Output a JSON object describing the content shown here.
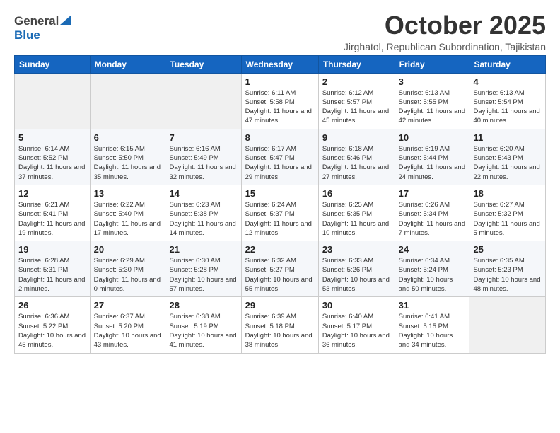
{
  "header": {
    "logo_line1": "General",
    "logo_line2": "Blue",
    "month_title": "October 2025",
    "subtitle": "Jirghatol, Republican Subordination, Tajikistan"
  },
  "weekdays": [
    "Sunday",
    "Monday",
    "Tuesday",
    "Wednesday",
    "Thursday",
    "Friday",
    "Saturday"
  ],
  "weeks": [
    [
      {
        "day": "",
        "info": ""
      },
      {
        "day": "",
        "info": ""
      },
      {
        "day": "",
        "info": ""
      },
      {
        "day": "1",
        "info": "Sunrise: 6:11 AM\nSunset: 5:58 PM\nDaylight: 11 hours\nand 47 minutes."
      },
      {
        "day": "2",
        "info": "Sunrise: 6:12 AM\nSunset: 5:57 PM\nDaylight: 11 hours\nand 45 minutes."
      },
      {
        "day": "3",
        "info": "Sunrise: 6:13 AM\nSunset: 5:55 PM\nDaylight: 11 hours\nand 42 minutes."
      },
      {
        "day": "4",
        "info": "Sunrise: 6:13 AM\nSunset: 5:54 PM\nDaylight: 11 hours\nand 40 minutes."
      }
    ],
    [
      {
        "day": "5",
        "info": "Sunrise: 6:14 AM\nSunset: 5:52 PM\nDaylight: 11 hours\nand 37 minutes."
      },
      {
        "day": "6",
        "info": "Sunrise: 6:15 AM\nSunset: 5:50 PM\nDaylight: 11 hours\nand 35 minutes."
      },
      {
        "day": "7",
        "info": "Sunrise: 6:16 AM\nSunset: 5:49 PM\nDaylight: 11 hours\nand 32 minutes."
      },
      {
        "day": "8",
        "info": "Sunrise: 6:17 AM\nSunset: 5:47 PM\nDaylight: 11 hours\nand 29 minutes."
      },
      {
        "day": "9",
        "info": "Sunrise: 6:18 AM\nSunset: 5:46 PM\nDaylight: 11 hours\nand 27 minutes."
      },
      {
        "day": "10",
        "info": "Sunrise: 6:19 AM\nSunset: 5:44 PM\nDaylight: 11 hours\nand 24 minutes."
      },
      {
        "day": "11",
        "info": "Sunrise: 6:20 AM\nSunset: 5:43 PM\nDaylight: 11 hours\nand 22 minutes."
      }
    ],
    [
      {
        "day": "12",
        "info": "Sunrise: 6:21 AM\nSunset: 5:41 PM\nDaylight: 11 hours\nand 19 minutes."
      },
      {
        "day": "13",
        "info": "Sunrise: 6:22 AM\nSunset: 5:40 PM\nDaylight: 11 hours\nand 17 minutes."
      },
      {
        "day": "14",
        "info": "Sunrise: 6:23 AM\nSunset: 5:38 PM\nDaylight: 11 hours\nand 14 minutes."
      },
      {
        "day": "15",
        "info": "Sunrise: 6:24 AM\nSunset: 5:37 PM\nDaylight: 11 hours\nand 12 minutes."
      },
      {
        "day": "16",
        "info": "Sunrise: 6:25 AM\nSunset: 5:35 PM\nDaylight: 11 hours\nand 10 minutes."
      },
      {
        "day": "17",
        "info": "Sunrise: 6:26 AM\nSunset: 5:34 PM\nDaylight: 11 hours\nand 7 minutes."
      },
      {
        "day": "18",
        "info": "Sunrise: 6:27 AM\nSunset: 5:32 PM\nDaylight: 11 hours\nand 5 minutes."
      }
    ],
    [
      {
        "day": "19",
        "info": "Sunrise: 6:28 AM\nSunset: 5:31 PM\nDaylight: 11 hours\nand 2 minutes."
      },
      {
        "day": "20",
        "info": "Sunrise: 6:29 AM\nSunset: 5:30 PM\nDaylight: 11 hours\nand 0 minutes."
      },
      {
        "day": "21",
        "info": "Sunrise: 6:30 AM\nSunset: 5:28 PM\nDaylight: 10 hours\nand 57 minutes."
      },
      {
        "day": "22",
        "info": "Sunrise: 6:32 AM\nSunset: 5:27 PM\nDaylight: 10 hours\nand 55 minutes."
      },
      {
        "day": "23",
        "info": "Sunrise: 6:33 AM\nSunset: 5:26 PM\nDaylight: 10 hours\nand 53 minutes."
      },
      {
        "day": "24",
        "info": "Sunrise: 6:34 AM\nSunset: 5:24 PM\nDaylight: 10 hours\nand 50 minutes."
      },
      {
        "day": "25",
        "info": "Sunrise: 6:35 AM\nSunset: 5:23 PM\nDaylight: 10 hours\nand 48 minutes."
      }
    ],
    [
      {
        "day": "26",
        "info": "Sunrise: 6:36 AM\nSunset: 5:22 PM\nDaylight: 10 hours\nand 45 minutes."
      },
      {
        "day": "27",
        "info": "Sunrise: 6:37 AM\nSunset: 5:20 PM\nDaylight: 10 hours\nand 43 minutes."
      },
      {
        "day": "28",
        "info": "Sunrise: 6:38 AM\nSunset: 5:19 PM\nDaylight: 10 hours\nand 41 minutes."
      },
      {
        "day": "29",
        "info": "Sunrise: 6:39 AM\nSunset: 5:18 PM\nDaylight: 10 hours\nand 38 minutes."
      },
      {
        "day": "30",
        "info": "Sunrise: 6:40 AM\nSunset: 5:17 PM\nDaylight: 10 hours\nand 36 minutes."
      },
      {
        "day": "31",
        "info": "Sunrise: 6:41 AM\nSunset: 5:15 PM\nDaylight: 10 hours\nand 34 minutes."
      },
      {
        "day": "",
        "info": ""
      }
    ]
  ]
}
